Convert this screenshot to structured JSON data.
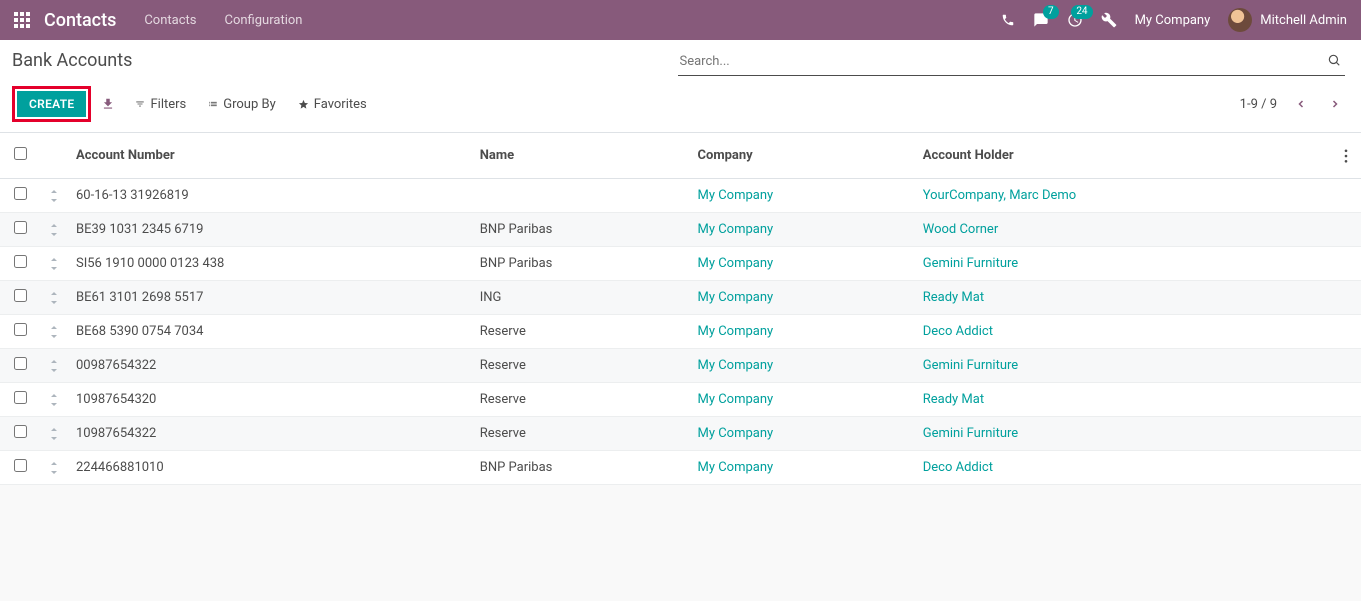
{
  "topbar": {
    "brand": "Contacts",
    "nav": [
      "Contacts",
      "Configuration"
    ],
    "chat_badge": "7",
    "activity_badge": "24",
    "company": "My Company",
    "user": "Mitchell Admin"
  },
  "header": {
    "title": "Bank Accounts",
    "search_placeholder": "Search...",
    "create_label": "CREATE",
    "filters_label": "Filters",
    "groupby_label": "Group By",
    "favorites_label": "Favorites",
    "pager": "1-9 / 9"
  },
  "columns": {
    "account_number": "Account Number",
    "name": "Name",
    "company": "Company",
    "account_holder": "Account Holder"
  },
  "rows": [
    {
      "acct": "60-16-13 31926819",
      "name": "",
      "company": "My Company",
      "holder": "YourCompany, Marc Demo"
    },
    {
      "acct": "BE39 1031 2345 6719",
      "name": "BNP Paribas",
      "company": "My Company",
      "holder": "Wood Corner"
    },
    {
      "acct": "SI56 1910 0000 0123 438",
      "name": "BNP Paribas",
      "company": "My Company",
      "holder": "Gemini Furniture"
    },
    {
      "acct": "BE61 3101 2698 5517",
      "name": "ING",
      "company": "My Company",
      "holder": "Ready Mat"
    },
    {
      "acct": "BE68 5390 0754 7034",
      "name": "Reserve",
      "company": "My Company",
      "holder": "Deco Addict"
    },
    {
      "acct": "00987654322",
      "name": "Reserve",
      "company": "My Company",
      "holder": "Gemini Furniture"
    },
    {
      "acct": "10987654320",
      "name": "Reserve",
      "company": "My Company",
      "holder": "Ready Mat"
    },
    {
      "acct": "10987654322",
      "name": "Reserve",
      "company": "My Company",
      "holder": "Gemini Furniture"
    },
    {
      "acct": "224466881010",
      "name": "BNP Paribas",
      "company": "My Company",
      "holder": "Deco Addict"
    }
  ]
}
